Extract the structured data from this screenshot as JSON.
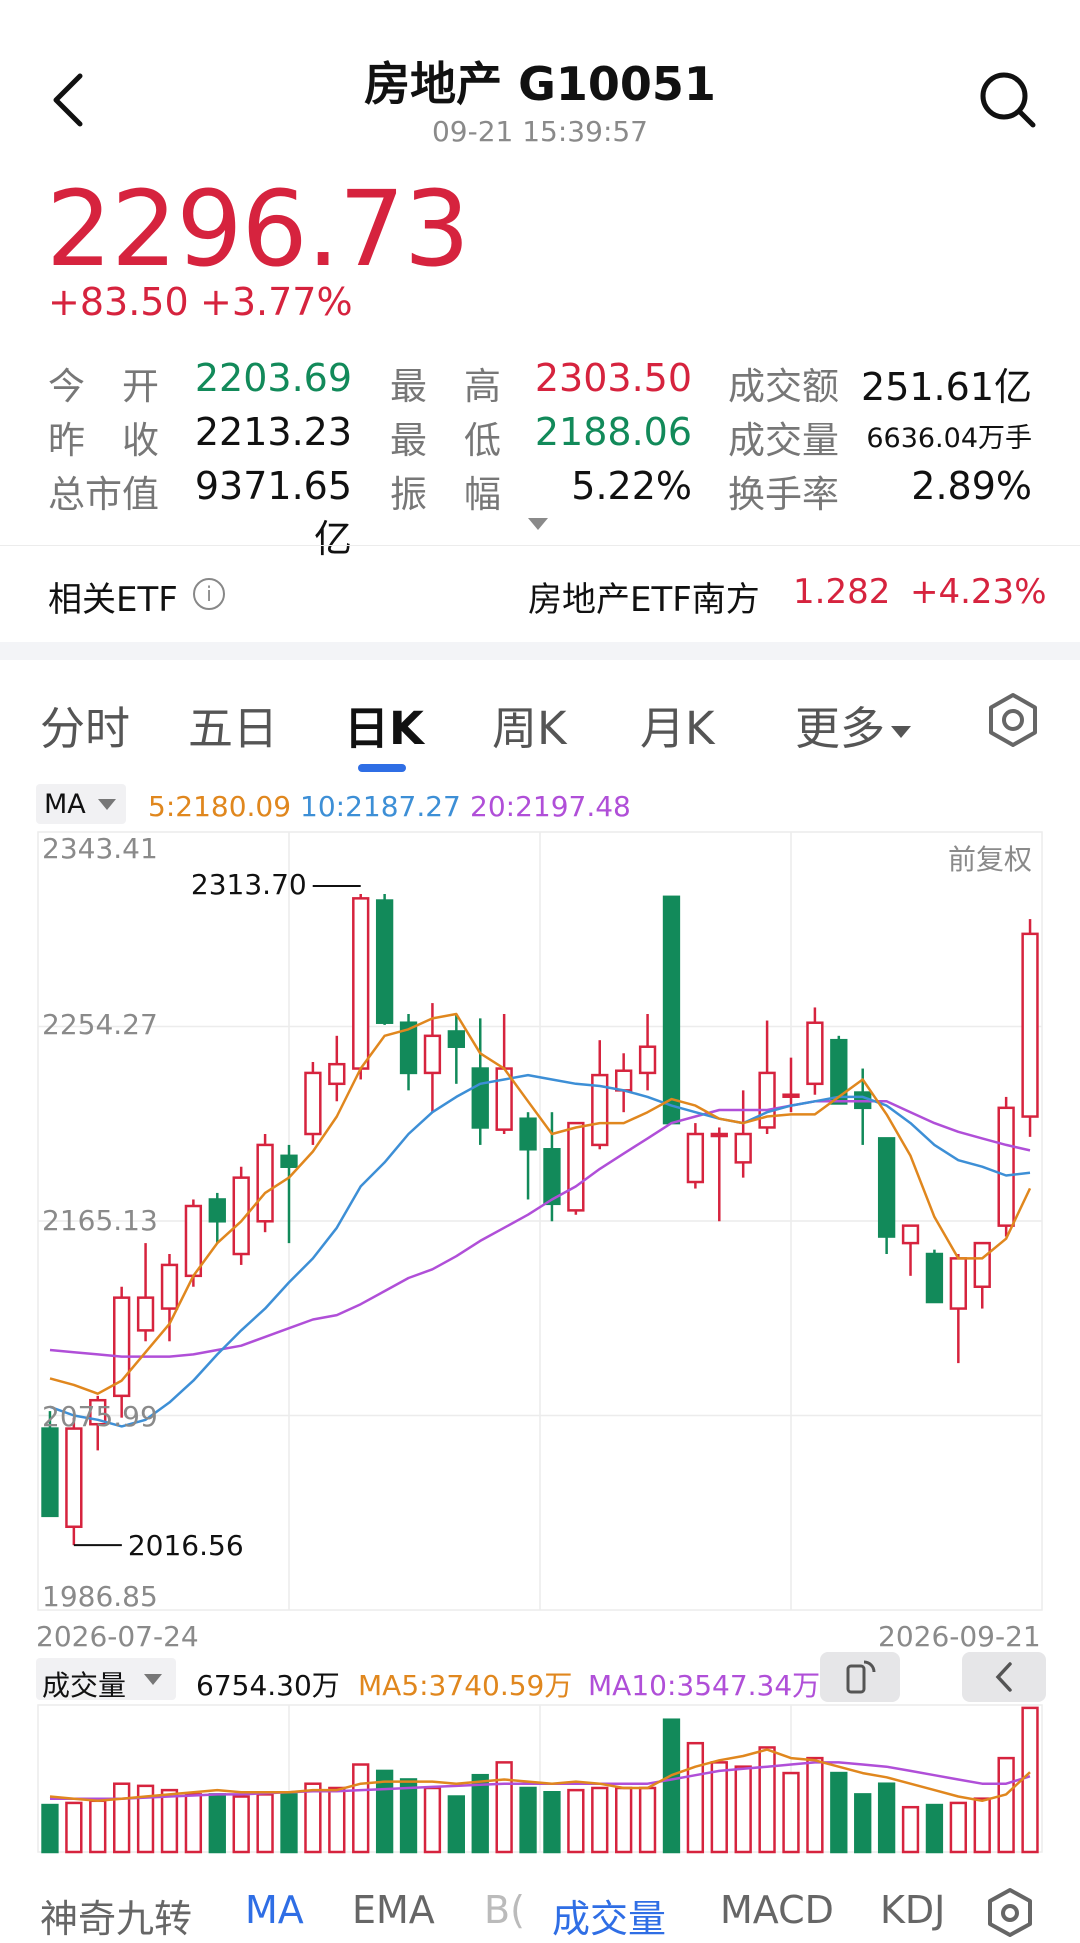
{
  "header": {
    "title": "房地产 G10051",
    "time": "09-21 15:39:57"
  },
  "quote": {
    "price": "2296.73",
    "change": "+83.50",
    "change_pct": "+3.77%"
  },
  "stats": [
    {
      "label": "今　开",
      "value": "2203.69",
      "color": "green"
    },
    {
      "label": "最　高",
      "value": "2303.50",
      "color": "red"
    },
    {
      "label": "成交额",
      "value": "251.61亿",
      "color": "black"
    },
    {
      "label": "昨　收",
      "value": "2213.23",
      "color": "black"
    },
    {
      "label": "最　低",
      "value": "2188.06",
      "color": "green"
    },
    {
      "label": "成交量",
      "value": "6636.04万手",
      "color": "black"
    },
    {
      "label": "总市值",
      "value": "9371.65亿",
      "color": "black"
    },
    {
      "label": "振　幅",
      "value": "5.22%",
      "color": "black"
    },
    {
      "label": "换手率",
      "value": "2.89%",
      "color": "black"
    }
  ],
  "etf": {
    "label": "相关ETF",
    "info_glyph": "i",
    "name": "房地产ETF南方",
    "price": "1.282",
    "change_pct": "+4.23%"
  },
  "tabs": [
    {
      "label": "分时"
    },
    {
      "label": "五日"
    },
    {
      "label": "日K"
    },
    {
      "label": "周K"
    },
    {
      "label": "月K"
    },
    {
      "label": "更多"
    }
  ],
  "active_tab": 2,
  "indicator": {
    "selector": "MA",
    "ma5": "5:2180.09",
    "ma10": "10:2187.27",
    "ma20": "20:2197.48",
    "adjust": "前复权"
  },
  "colors": {
    "up": "#d6233e",
    "down": "#128a5a",
    "ma5": "#e0871e",
    "ma10": "#3d8fd6",
    "ma20": "#b04fd8",
    "accent": "#2f6ee5"
  },
  "chart_data": {
    "type": "candlestick",
    "x_start": "2026-07-24",
    "x_end": "2026-09-21",
    "y_ticks": [
      "2343.41",
      "2254.27",
      "2165.13",
      "2075.99",
      "1986.85"
    ],
    "ylim": [
      1986.85,
      2343.41
    ],
    "max_label": "2313.70",
    "min_label": "2016.56",
    "candles": [
      {
        "o": 2070,
        "h": 2078,
        "l": 2030,
        "c": 2030
      },
      {
        "o": 2025,
        "h": 2075,
        "l": 2016.56,
        "c": 2070
      },
      {
        "o": 2072,
        "h": 2085,
        "l": 2060,
        "c": 2083
      },
      {
        "o": 2085,
        "h": 2135,
        "l": 2075,
        "c": 2130
      },
      {
        "o": 2115,
        "h": 2155,
        "l": 2110,
        "c": 2130
      },
      {
        "o": 2125,
        "h": 2150,
        "l": 2110,
        "c": 2145
      },
      {
        "o": 2140,
        "h": 2175,
        "l": 2135,
        "c": 2172
      },
      {
        "o": 2175,
        "h": 2178,
        "l": 2155,
        "c": 2165
      },
      {
        "o": 2150,
        "h": 2190,
        "l": 2145,
        "c": 2185
      },
      {
        "o": 2165,
        "h": 2205,
        "l": 2160,
        "c": 2200
      },
      {
        "o": 2195,
        "h": 2200,
        "l": 2155,
        "c": 2190
      },
      {
        "o": 2205,
        "h": 2238,
        "l": 2200,
        "c": 2233
      },
      {
        "o": 2228,
        "h": 2250,
        "l": 2220,
        "c": 2237
      },
      {
        "o": 2235,
        "h": 2315,
        "l": 2230,
        "c": 2313
      },
      {
        "o": 2312,
        "h": 2315,
        "l": 2255,
        "c": 2256
      },
      {
        "o": 2256,
        "h": 2260,
        "l": 2225,
        "c": 2233
      },
      {
        "o": 2233,
        "h": 2265,
        "l": 2215,
        "c": 2250
      },
      {
        "o": 2252,
        "h": 2260,
        "l": 2228,
        "c": 2245
      },
      {
        "o": 2235,
        "h": 2258,
        "l": 2200,
        "c": 2208
      },
      {
        "o": 2207,
        "h": 2260,
        "l": 2205,
        "c": 2235
      },
      {
        "o": 2212,
        "h": 2215,
        "l": 2175,
        "c": 2198
      },
      {
        "o": 2198,
        "h": 2215,
        "l": 2165,
        "c": 2173
      },
      {
        "o": 2170,
        "h": 2210,
        "l": 2168,
        "c": 2210
      },
      {
        "o": 2200,
        "h": 2248,
        "l": 2198,
        "c": 2232
      },
      {
        "o": 2225,
        "h": 2242,
        "l": 2215,
        "c": 2234
      },
      {
        "o": 2233,
        "h": 2260,
        "l": 2225,
        "c": 2245
      },
      {
        "o": 2313.7,
        "h": 2313.7,
        "l": 2210,
        "c": 2210
      },
      {
        "o": 2183,
        "h": 2210,
        "l": 2180,
        "c": 2205
      },
      {
        "o": 2205,
        "h": 2208,
        "l": 2165,
        "c": 2205
      },
      {
        "o": 2192,
        "h": 2225,
        "l": 2185,
        "c": 2205
      },
      {
        "o": 2208,
        "h": 2257,
        "l": 2205,
        "c": 2233
      },
      {
        "o": 2223,
        "h": 2240,
        "l": 2215,
        "c": 2223
      },
      {
        "o": 2228,
        "h": 2263,
        "l": 2223,
        "c": 2256
      },
      {
        "o": 2248,
        "h": 2250,
        "l": 2219,
        "c": 2219
      },
      {
        "o": 2224,
        "h": 2235,
        "l": 2200,
        "c": 2217
      },
      {
        "o": 2203,
        "h": 2203,
        "l": 2150,
        "c": 2158
      },
      {
        "o": 2155,
        "h": 2163,
        "l": 2140,
        "c": 2163
      },
      {
        "o": 2150,
        "h": 2152,
        "l": 2128,
        "c": 2128
      },
      {
        "o": 2125,
        "h": 2150,
        "l": 2100,
        "c": 2148
      },
      {
        "o": 2135,
        "h": 2155,
        "l": 2125,
        "c": 2155
      },
      {
        "o": 2163,
        "h": 2222,
        "l": 2158,
        "c": 2217
      },
      {
        "o": 2213,
        "h": 2303.5,
        "l": 2203.69,
        "c": 2296.73
      }
    ],
    "ma5": [
      2093,
      2090,
      2086,
      2092,
      2105,
      2118,
      2140,
      2155,
      2165,
      2178,
      2185,
      2197,
      2213,
      2235,
      2250,
      2253,
      2258,
      2260,
      2242,
      2235,
      2220,
      2205,
      2208,
      2210,
      2210,
      2215,
      2221,
      2218,
      2212,
      2210,
      2213,
      2214,
      2214,
      2222,
      2230,
      2214,
      2195,
      2167,
      2148,
      2148,
      2157,
      2180.09
    ],
    "ma10": [
      2080,
      2076,
      2074,
      2071,
      2074,
      2082,
      2092,
      2104,
      2115,
      2125,
      2137,
      2148,
      2162,
      2181,
      2192,
      2205,
      2215,
      2222,
      2228,
      2230,
      2232,
      2230,
      2228,
      2227,
      2225,
      2222,
      2218,
      2215,
      2212,
      2210,
      2215,
      2218,
      2220,
      2222,
      2222,
      2218,
      2210,
      2200,
      2193,
      2190,
      2186,
      2187.27
    ],
    "ma20": [
      2106,
      2105,
      2104,
      2103,
      2103,
      2103,
      2104,
      2106,
      2108,
      2112,
      2116,
      2120,
      2122,
      2127,
      2133,
      2139,
      2143,
      2149,
      2156,
      2162,
      2168,
      2175,
      2181,
      2189,
      2196,
      2203,
      2210,
      2213,
      2216,
      2216,
      2216,
      2218,
      2220,
      2220,
      2220,
      2220,
      2215,
      2210,
      2206,
      2203,
      2200,
      2197.48
    ]
  },
  "volume": {
    "selector": "成交量",
    "current": "6754.30万",
    "ma5": "MA5:3740.59万",
    "ma10": "MA10:3547.34万",
    "scale_max": 6754.3,
    "bars": [
      2200,
      2300,
      2400,
      3200,
      3100,
      2900,
      2700,
      2700,
      2600,
      2700,
      2700,
      3200,
      3000,
      4100,
      3800,
      3400,
      3000,
      2600,
      3600,
      4200,
      3000,
      2800,
      2900,
      3000,
      3000,
      3000,
      6200,
      5100,
      4200,
      4000,
      4900,
      3700,
      4400,
      3700,
      2700,
      3200,
      2100,
      2200,
      2300,
      2500,
      4400,
      6754.3
    ],
    "ma5_line": [
      2600,
      2500,
      2400,
      2500,
      2600,
      2700,
      2800,
      2900,
      2800,
      2800,
      2800,
      2900,
      2900,
      3200,
      3300,
      3300,
      3300,
      3200,
      3300,
      3400,
      3300,
      3200,
      3300,
      3200,
      3000,
      3000,
      3600,
      4000,
      4300,
      4500,
      4800,
      4400,
      4300,
      4000,
      3700,
      3500,
      3200,
      2900,
      2600,
      2400,
      2700,
      3740.59
    ],
    "ma10_line": [
      2500,
      2500,
      2500,
      2500,
      2550,
      2600,
      2650,
      2700,
      2700,
      2750,
      2800,
      2850,
      2850,
      2900,
      2950,
      3000,
      3050,
      3100,
      3150,
      3200,
      3200,
      3200,
      3200,
      3200,
      3200,
      3200,
      3400,
      3600,
      3800,
      3900,
      4000,
      4100,
      4200,
      4200,
      4100,
      4000,
      3800,
      3600,
      3400,
      3200,
      3200,
      3547.34
    ]
  },
  "bottom_tabs": [
    {
      "label": "神奇九转"
    },
    {
      "label": "MA"
    },
    {
      "label": "EMA"
    },
    {
      "label": "B("
    },
    {
      "label": "成交量"
    },
    {
      "label": "MACD"
    },
    {
      "label": "KDJ"
    }
  ]
}
